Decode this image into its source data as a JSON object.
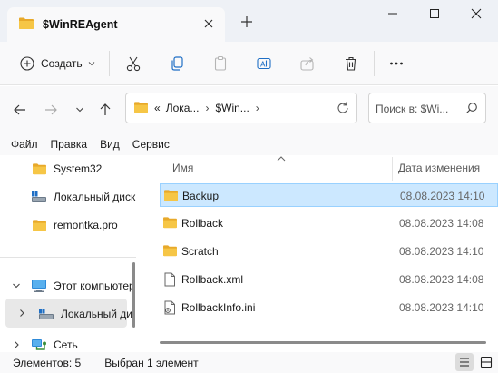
{
  "tab": {
    "title": "$WinREAgent"
  },
  "toolbar": {
    "create_label": "Создать"
  },
  "address": {
    "overflow": "«",
    "crumbs": [
      "Лока...",
      "$Win..."
    ],
    "search_placeholder": "Поиск в: $Wi..."
  },
  "menu": [
    "Файл",
    "Правка",
    "Вид",
    "Сервис"
  ],
  "nav": {
    "items": [
      {
        "label": "System32"
      },
      {
        "label": "Локальный диск"
      },
      {
        "label": "remontka.pro"
      },
      {
        "label": "Этот компьютер"
      },
      {
        "label": "Локальный ди"
      },
      {
        "label": "Сеть"
      }
    ]
  },
  "columns": {
    "name": "Имя",
    "date": "Дата изменения"
  },
  "files": [
    {
      "name": "Backup",
      "date": "08.08.2023 14:10",
      "type": "folder",
      "selected": true
    },
    {
      "name": "Rollback",
      "date": "08.08.2023 14:08",
      "type": "folder",
      "selected": false
    },
    {
      "name": "Scratch",
      "date": "08.08.2023 14:10",
      "type": "folder",
      "selected": false
    },
    {
      "name": "Rollback.xml",
      "date": "08.08.2023 14:08",
      "type": "xml-file",
      "selected": false
    },
    {
      "name": "RollbackInfo.ini",
      "date": "08.08.2023 14:10",
      "type": "ini-file",
      "selected": false
    }
  ],
  "status": {
    "count": "Элементов: 5",
    "selected": "Выбран 1 элемент"
  },
  "colors": {
    "folder": "#f4c542",
    "selection": "#cce8ff",
    "selection_border": "#99d1ff",
    "accent": "#0067c0"
  }
}
